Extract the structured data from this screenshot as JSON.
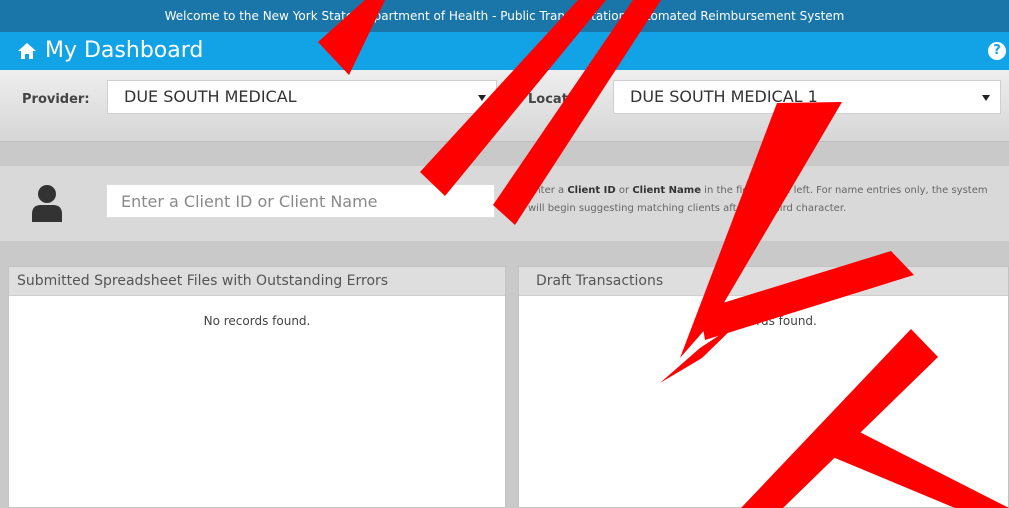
{
  "banner": {
    "text": "Welcome to the New York State Department of Health - Public Transportation Automated Reimbursement System"
  },
  "header": {
    "title": "My Dashboard",
    "home_icon": "home-icon",
    "help_icon": "help-icon",
    "help_glyph": "?"
  },
  "filters": {
    "provider_label": "Provider:",
    "provider_value": "DUE SOUTH MEDICAL",
    "location_label": "Location:",
    "location_value": "DUE SOUTH MEDICAL 1"
  },
  "client_search": {
    "icon": "person-icon",
    "placeholder": "Enter a Client ID or Client Name",
    "help": {
      "part1": "Enter a ",
      "client_id": "Client ID",
      "part2": " or ",
      "client_name": "Client Name",
      "part3": " in the field to the left. For name entries only, the system will begin suggesting matching clients after the third character."
    }
  },
  "panels": {
    "errors": {
      "title": "Submitted Spreadsheet Files with Outstanding Errors",
      "empty": "No records found."
    },
    "drafts": {
      "title": "Draft Transactions",
      "empty": "No records found."
    }
  },
  "colors": {
    "banner": "#1a75a8",
    "header": "#12a3e6",
    "watermark": "#ff0000"
  }
}
